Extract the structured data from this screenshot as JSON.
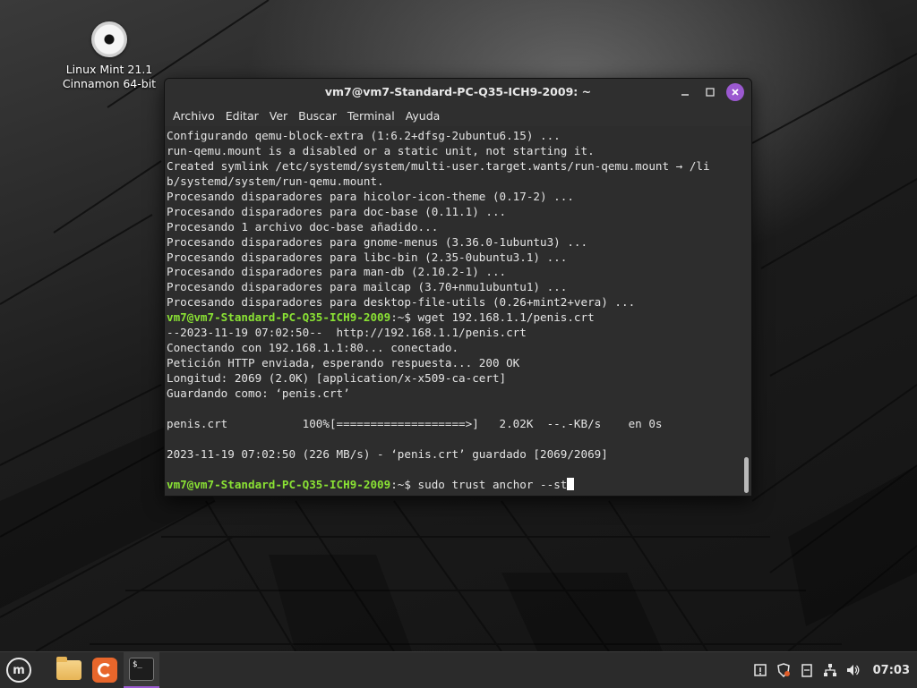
{
  "desktop": {
    "icon_label_line1": "Linux Mint 21.1",
    "icon_label_line2": "Cinnamon 64-bit"
  },
  "window": {
    "title": "vm7@vm7-Standard-PC-Q35-ICH9-2009: ~",
    "menu": [
      "Archivo",
      "Editar",
      "Ver",
      "Buscar",
      "Terminal",
      "Ayuda"
    ]
  },
  "terminal": {
    "lines": [
      {
        "text": "Configurando qemu-block-extra (1:6.2+dfsg-2ubuntu6.15) ..."
      },
      {
        "text": "run-qemu.mount is a disabled or a static unit, not starting it."
      },
      {
        "text": "Created symlink /etc/systemd/system/multi-user.target.wants/run-qemu.mount → /li"
      },
      {
        "text": "b/systemd/system/run-qemu.mount."
      },
      {
        "text": "Procesando disparadores para hicolor-icon-theme (0.17-2) ..."
      },
      {
        "text": "Procesando disparadores para doc-base (0.11.1) ..."
      },
      {
        "text": "Procesando 1 archivo doc-base añadido..."
      },
      {
        "text": "Procesando disparadores para gnome-menus (3.36.0-1ubuntu3) ..."
      },
      {
        "text": "Procesando disparadores para libc-bin (2.35-0ubuntu3.1) ..."
      },
      {
        "text": "Procesando disparadores para man-db (2.10.2-1) ..."
      },
      {
        "text": "Procesando disparadores para mailcap (3.70+nmu1ubuntu1) ..."
      },
      {
        "text": "Procesando disparadores para desktop-file-utils (0.26+mint2+vera) ..."
      },
      {
        "prompt": "vm7@vm7-Standard-PC-Q35-ICH9-2009",
        "cmd": ":~$ wget 192.168.1.1/penis.crt"
      },
      {
        "text": "--2023-11-19 07:02:50--  http://192.168.1.1/penis.crt"
      },
      {
        "text": "Conectando con 192.168.1.1:80... conectado."
      },
      {
        "text": "Petición HTTP enviada, esperando respuesta... 200 OK"
      },
      {
        "text": "Longitud: 2069 (2.0K) [application/x-x509-ca-cert]"
      },
      {
        "text": "Guardando como: ‘penis.crt’"
      },
      {
        "text": ""
      },
      {
        "text": "penis.crt           100%[===================>]   2.02K  --.-KB/s    en 0s"
      },
      {
        "text": ""
      },
      {
        "text": "2023-11-19 07:02:50 (226 MB/s) - ‘penis.crt’ guardado [2069/2069]"
      },
      {
        "text": ""
      },
      {
        "prompt": "vm7@vm7-Standard-PC-Q35-ICH9-2009",
        "cmd": ":~$ sudo trust anchor --st",
        "cursor": true
      }
    ]
  },
  "taskbar": {
    "clock": "07:03",
    "terminal_icon_text": "$_"
  },
  "colors": {
    "prompt": "#8ae234",
    "close_button": "#9b59d0"
  }
}
